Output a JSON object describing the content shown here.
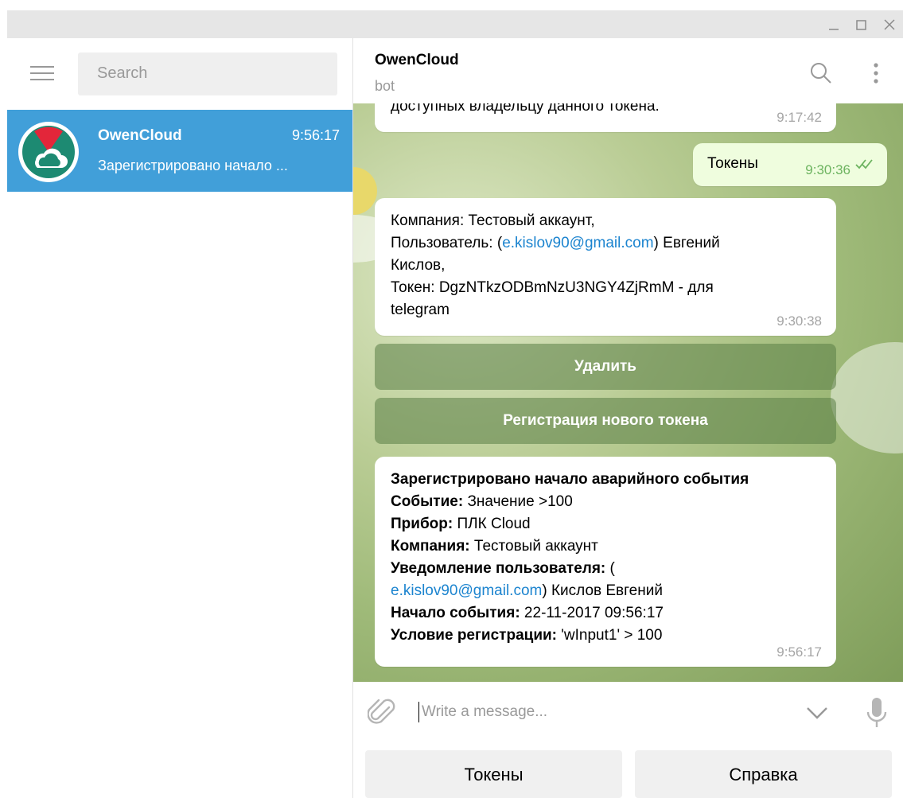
{
  "window": {
    "controls": [
      "minimize-icon",
      "maximize-icon",
      "close-icon"
    ]
  },
  "sidebar": {
    "search_placeholder": "Search",
    "chats": [
      {
        "name": "OwenCloud",
        "time": "9:56:17",
        "preview": "Зарегистрировано начало ...",
        "active": true
      }
    ]
  },
  "header": {
    "title": "OwenCloud",
    "status": "bot"
  },
  "messages": {
    "partial": {
      "text": "доступных владельцу данного токена.",
      "time": "9:17:42"
    },
    "outgoing": {
      "text": "Токены",
      "time": "9:30:36"
    },
    "token_info": {
      "line1": "Компания: Тестовый аккаунт,",
      "line2_prefix": "Пользователь: (",
      "email": "e.kislov90@gmail.com",
      "line2_suffix": ") Евгений",
      "line3": "Кислов,",
      "line4": "Токен: DgzNTkzODBmNzU3NGY4ZjRmM - для",
      "line5": "telegram",
      "time": "9:30:38"
    },
    "inline_buttons": [
      "Удалить",
      "Регистрация нового токена"
    ],
    "alarm": {
      "title": "Зарегистрировано начало аварийного события",
      "event_label": "Событие:",
      "event_value": " Значение >100",
      "device_label": "Прибор:",
      "device_value": " ПЛК Cloud",
      "company_label": "Компания:",
      "company_value": " Тестовый аккаунт",
      "notify_label": "Уведомление пользователя:",
      "notify_value": " (",
      "email": "e.kislov90@gmail.com",
      "notify_suffix": ") Кислов Евгений",
      "start_label": "Начало события:",
      "start_value": " 22-11-2017 09:56:17",
      "cond_label": "Условие регистрации:",
      "cond_value": " 'wInput1' > 100",
      "time": "9:56:17"
    }
  },
  "composer": {
    "placeholder": "Write a message..."
  },
  "keyboard": {
    "buttons": [
      "Токены",
      "Справка"
    ]
  },
  "colors": {
    "accent": "#419fd9",
    "link": "#1c84cf",
    "outgoing_bubble": "#effdde",
    "check": "#6cb35f"
  }
}
